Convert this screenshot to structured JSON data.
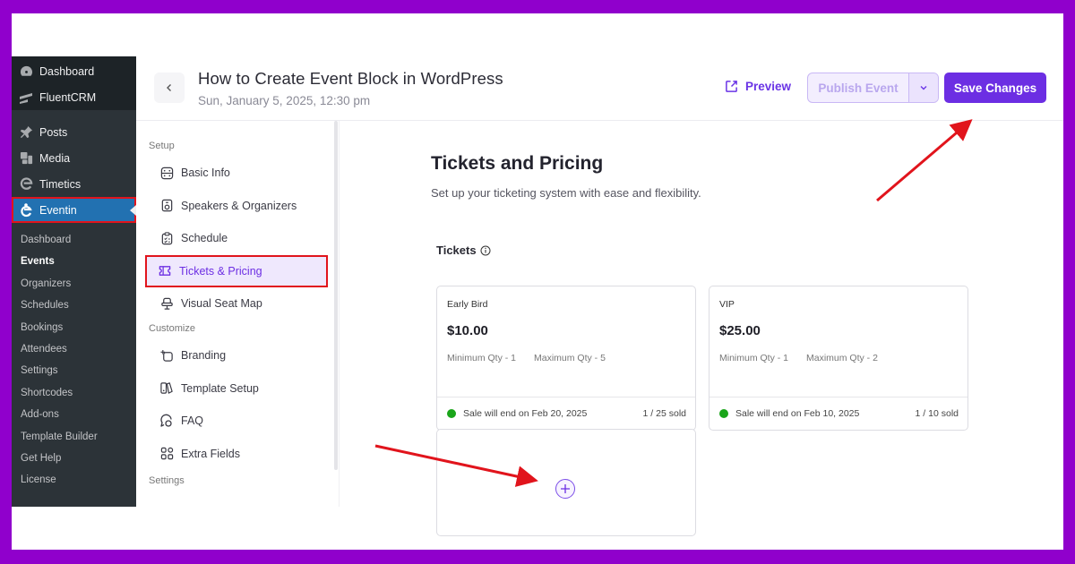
{
  "wp_menu": {
    "top_items": [
      {
        "label": "Dashboard",
        "icon": "dashboard-icon"
      },
      {
        "label": "FluentCRM",
        "icon": "fluentcrm-icon"
      }
    ],
    "items": [
      {
        "label": "Posts",
        "icon": "pin-icon"
      },
      {
        "label": "Media",
        "icon": "media-icon"
      },
      {
        "label": "Timetics",
        "icon": "timetics-icon"
      },
      {
        "label": "Eventin",
        "icon": "eventin-icon",
        "active": true
      }
    ],
    "submenu": [
      {
        "label": "Dashboard"
      },
      {
        "label": "Events",
        "current": true
      },
      {
        "label": "Organizers"
      },
      {
        "label": "Schedules"
      },
      {
        "label": "Bookings"
      },
      {
        "label": "Attendees"
      },
      {
        "label": "Settings"
      },
      {
        "label": "Shortcodes"
      },
      {
        "label": "Add-ons"
      },
      {
        "label": "Template Builder"
      },
      {
        "label": "Get Help"
      },
      {
        "label": "License"
      }
    ]
  },
  "header": {
    "title": "How to Create Event Block in WordPress",
    "date": "Sun, January 5, 2025, 12:30 pm",
    "preview_label": "Preview",
    "publish_label": "Publish Event",
    "save_label": "Save Changes"
  },
  "subnav": {
    "sections": [
      {
        "label": "Setup",
        "items": [
          {
            "label": "Basic Info",
            "icon": "basic-info-icon"
          },
          {
            "label": "Speakers & Organizers",
            "icon": "speaker-icon"
          },
          {
            "label": "Schedule",
            "icon": "schedule-icon"
          },
          {
            "label": "Tickets & Pricing",
            "icon": "ticket-icon",
            "selected": true
          },
          {
            "label": "Visual Seat Map",
            "icon": "seat-icon"
          }
        ]
      },
      {
        "label": "Customize",
        "items": [
          {
            "label": "Branding",
            "icon": "branding-icon"
          },
          {
            "label": "Template Setup",
            "icon": "template-icon"
          },
          {
            "label": "FAQ",
            "icon": "faq-icon"
          },
          {
            "label": "Extra Fields",
            "icon": "extra-fields-icon"
          }
        ]
      },
      {
        "label": "Settings",
        "items": []
      }
    ]
  },
  "main": {
    "title": "Tickets and Pricing",
    "subtitle": "Set up your ticketing system with ease and flexibility.",
    "tickets_label": "Tickets",
    "tickets": [
      {
        "name": "Early Bird",
        "price": "$10.00",
        "min_qty": "Minimum Qty - 1",
        "max_qty": "Maximum Qty - 5",
        "status": "Sale will end on Feb 20, 2025",
        "sold": "1 / 25 sold"
      },
      {
        "name": "VIP",
        "price": "$25.00",
        "min_qty": "Minimum Qty - 1",
        "max_qty": "Maximum Qty - 2",
        "status": "Sale will end on Feb 10, 2025",
        "sold": "1 / 10 sold"
      }
    ]
  },
  "colors": {
    "accent": "#6c2ee3",
    "wp_sidebar": "#2c3338",
    "wp_active": "#2271b1",
    "status_green": "#1aa51a",
    "annotation_red": "#e1141c",
    "frame_border": "#9000cc"
  }
}
